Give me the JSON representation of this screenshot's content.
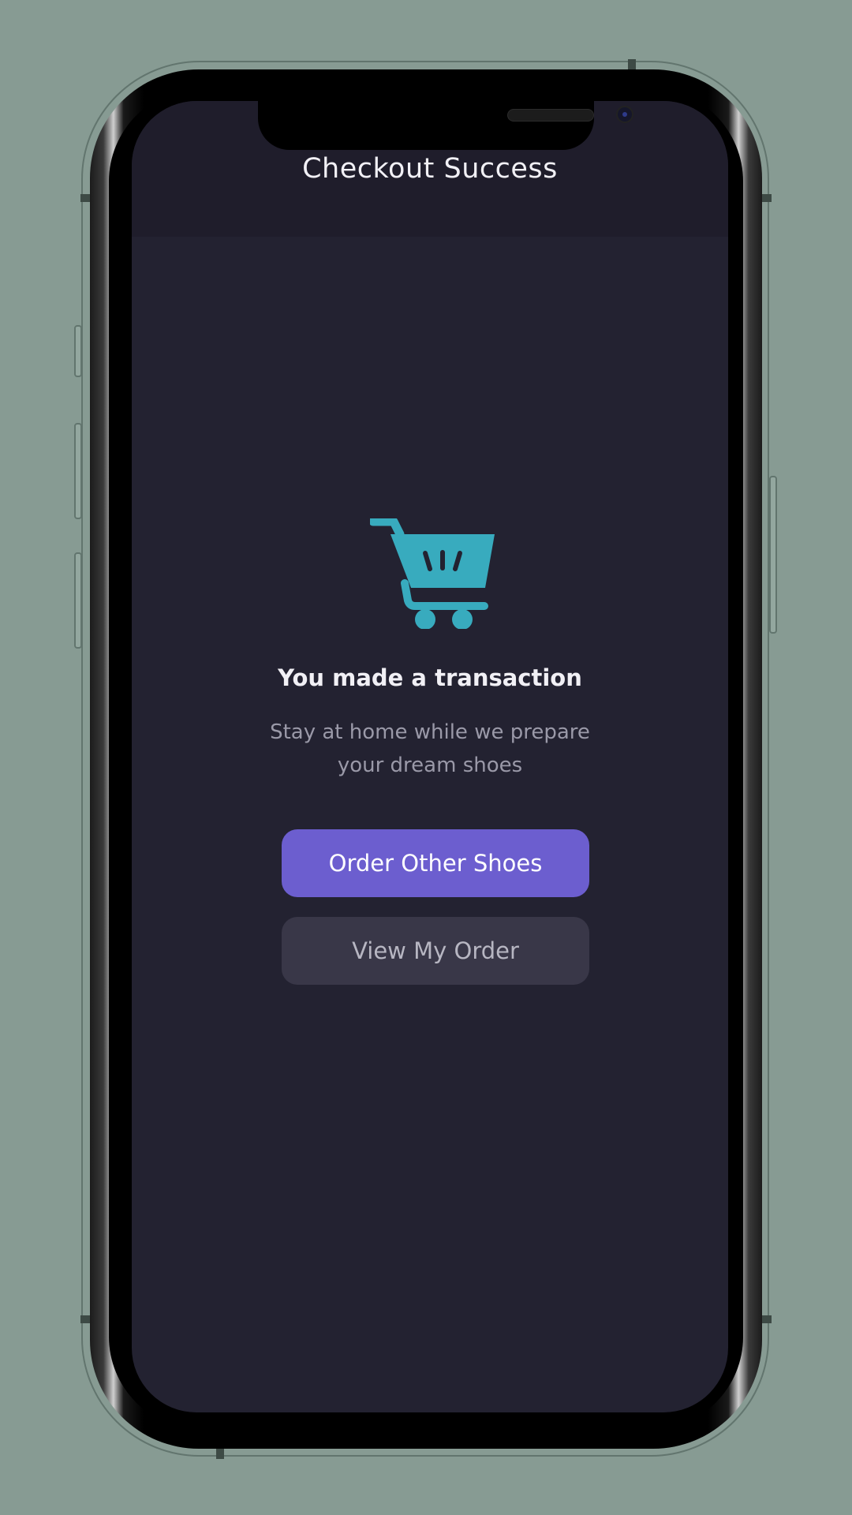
{
  "app": {
    "title": "Checkout Success"
  },
  "icons": {
    "cart": "shopping-cart-icon"
  },
  "success": {
    "headline": "You made a transaction",
    "subtext": "Stay at home while we prepare your dream shoes"
  },
  "actions": {
    "primary_label": "Order Other Shoes",
    "secondary_label": "View My Order"
  },
  "colors": {
    "background": "#232231",
    "header": "#1f1d2b",
    "accent": "#6c5ecf",
    "cart_icon": "#38abbe",
    "secondary_button": "#393748"
  }
}
